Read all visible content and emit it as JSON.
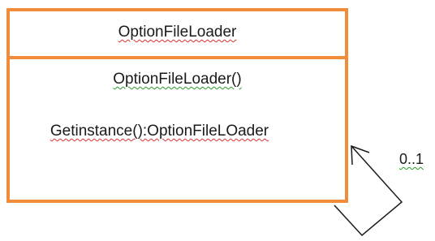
{
  "class": {
    "name": "OptionFileLoader",
    "methods": [
      "OptionFileLoader()",
      "Getinstance():OptionFileLOader"
    ]
  },
  "association": {
    "multiplicity": "0..1"
  },
  "colors": {
    "border": "#f08c3a",
    "line": "#1a1a1a",
    "spell_error": "#e03030",
    "grammar_mark": "#2a9a2a"
  }
}
